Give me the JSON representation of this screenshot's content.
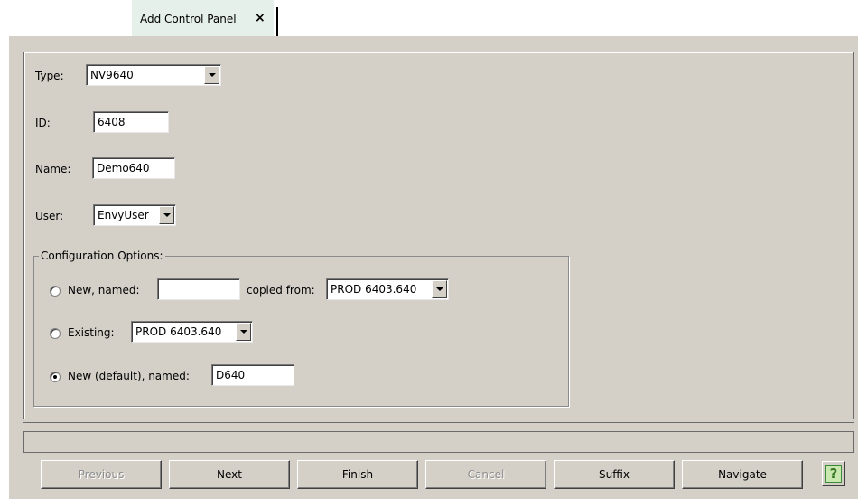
{
  "tab": {
    "title": "Add Control Panel",
    "close_glyph": "×"
  },
  "form": {
    "type_label": "Type:",
    "type_value": "NV9640",
    "id_label": "ID:",
    "id_value": "6408",
    "name_label": "Name:",
    "name_value": "Demo640",
    "user_label": "User:",
    "user_value": "EnvyUser"
  },
  "config": {
    "title": "Configuration Options:",
    "new_named_label": "New, named:",
    "new_named_value": "",
    "copied_from_label": "copied from:",
    "copied_from_value": "PROD 6403.640",
    "existing_label": "Existing:",
    "existing_value": "PROD 6403.640",
    "new_default_label": "New (default), named:",
    "new_default_value": "D640",
    "selected_option": "new_default"
  },
  "status": {
    "text": ""
  },
  "buttons": {
    "previous": "Previous",
    "next": "Next",
    "finish": "Finish",
    "cancel": "Cancel",
    "suffix": "Suffix",
    "navigate": "Navigate",
    "help_glyph": "?"
  },
  "icons": [
    "close-icon",
    "chevron-down-icon",
    "help-icon",
    "radio-icon"
  ],
  "colors": {
    "background": "#d4d0c8",
    "tab_background": "#e6f0ea",
    "disabled_text": "#8c8c8c",
    "help_green": "#c8e8b0"
  }
}
